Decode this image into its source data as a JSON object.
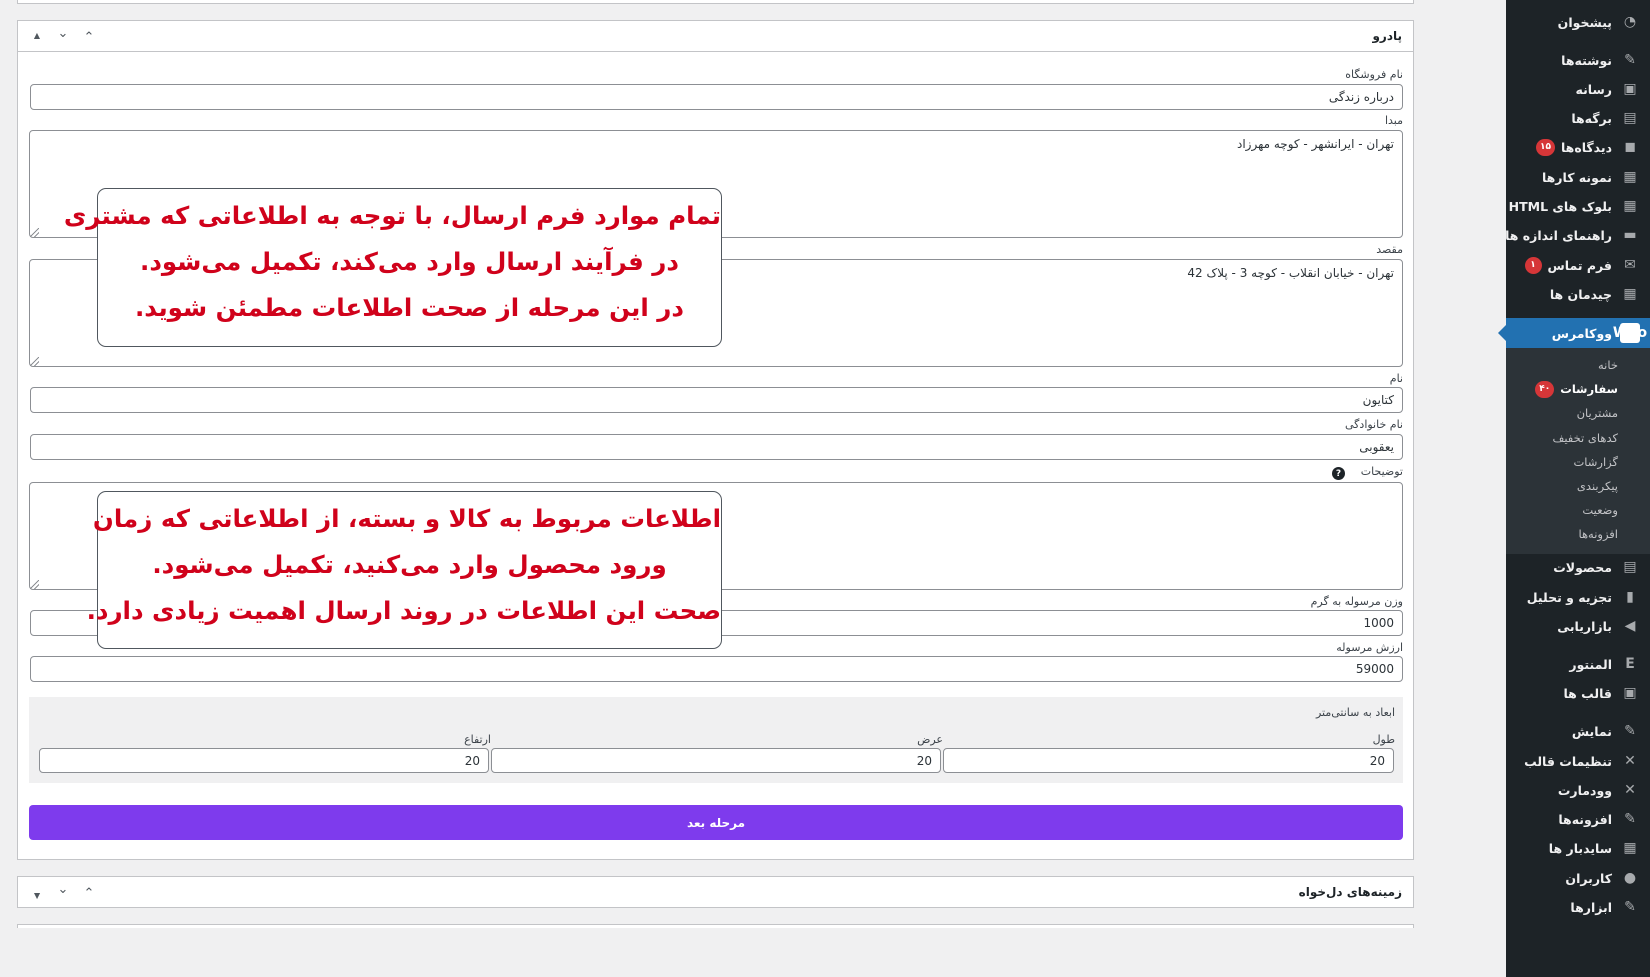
{
  "sidebar": {
    "items": [
      {
        "label": "پیشخوان",
        "icon": "dashboard-icon",
        "glyph": "◔"
      },
      {
        "label": "نوشته‌ها",
        "icon": "pin-icon",
        "glyph": "✎"
      },
      {
        "label": "رسانه",
        "icon": "media-icon",
        "glyph": "▣"
      },
      {
        "label": "برگه‌ها",
        "icon": "pages-icon",
        "glyph": "▤"
      },
      {
        "label": "دیدگاه‌ها",
        "icon": "comments-icon",
        "glyph": "◼",
        "badge": "۱۵"
      },
      {
        "label": "نمونه کارها",
        "icon": "portfolio-icon",
        "glyph": "▦"
      },
      {
        "label": "بلوک های HTML",
        "icon": "blocks-icon",
        "glyph": "▦"
      },
      {
        "label": "راهنمای اندازه ها",
        "icon": "size-guide-icon",
        "glyph": "▬"
      },
      {
        "label": "فرم تماس",
        "icon": "mail-icon",
        "glyph": "✉",
        "badge": "۱"
      },
      {
        "label": "چیدمان ها",
        "icon": "layouts-icon",
        "glyph": "▦"
      },
      {
        "label": "ووکامرس",
        "icon": "woocommerce-icon",
        "glyph": "Woo"
      },
      {
        "label": "محصولات",
        "icon": "products-icon",
        "glyph": "▤"
      },
      {
        "label": "تجزیه و تحلیل",
        "icon": "analytics-icon",
        "glyph": "▮"
      },
      {
        "label": "بازاریابی",
        "icon": "megaphone-icon",
        "glyph": "◀"
      },
      {
        "label": "المنتور",
        "icon": "elementor-icon",
        "glyph": "Ε"
      },
      {
        "label": "قالب ها",
        "icon": "templates-icon",
        "glyph": "▣"
      },
      {
        "label": "نمایش",
        "icon": "appearance-icon",
        "glyph": "✎"
      },
      {
        "label": "تنظیمات قالب",
        "icon": "theme-settings-icon",
        "glyph": "✕"
      },
      {
        "label": "وودمارت",
        "icon": "woodmart-icon",
        "glyph": "✕"
      },
      {
        "label": "افزونه‌ها",
        "icon": "plugins-icon",
        "glyph": "✎"
      },
      {
        "label": "سایدبار ها",
        "icon": "sidebars-icon",
        "glyph": "▦"
      },
      {
        "label": "کاربران",
        "icon": "users-icon",
        "glyph": "●"
      },
      {
        "label": "ابزارها",
        "icon": "tools-icon",
        "glyph": "✎"
      }
    ],
    "submenu": [
      {
        "label": "خانه"
      },
      {
        "label": "سفارشات",
        "badge": "۴۰"
      },
      {
        "label": "مشتریان"
      },
      {
        "label": "کدهای تخفیف"
      },
      {
        "label": "گزارشات"
      },
      {
        "label": "پیکربندی"
      },
      {
        "label": "وضعیت"
      },
      {
        "label": "افزونه‌ها"
      }
    ]
  },
  "panel": {
    "title": "پادرو",
    "controls": {
      "up": "▲",
      "collapse_down": "⌄",
      "expand_up": "⌃"
    },
    "fields": {
      "store_name": {
        "label": "نام فروشگاه",
        "value": "درباره زندگی"
      },
      "origin": {
        "label": "مبدا",
        "value": "تهران - ایرانشهر - کوچه مهرزاد"
      },
      "destination": {
        "label": "مقصد",
        "value": "تهران - خیابان انقلاب - کوچه 3 - پلاک 42"
      },
      "first_name": {
        "label": "نام",
        "value": "کتایون"
      },
      "last_name": {
        "label": "نام خانوادگی",
        "value": "یعقوبی"
      },
      "description": {
        "label": "توضیحات",
        "value": "",
        "help": "?"
      },
      "weight": {
        "label": "وزن مرسوله به گرم",
        "value": "1000"
      },
      "value": {
        "label": "ارزش مرسوله",
        "value": "59000"
      }
    },
    "dimensions": {
      "title": "ابعاد به سانتی‌متر",
      "length": {
        "label": "طول",
        "value": "20"
      },
      "width": {
        "label": "عرض",
        "value": "20"
      },
      "height": {
        "label": "ارتفاع",
        "value": "20"
      }
    },
    "next_button": "مرحله بعد"
  },
  "custom_fields_panel": {
    "title": "زمینه‌های دل‌خواه"
  },
  "callouts": {
    "first": {
      "line1": "تمام موارد فرم ارسال، با توجه به اطلاعاتی که مشتری",
      "line2": "در فرآیند ارسال وارد می‌کند، تکمیل می‌شود.",
      "line3": "در این مرحله از صحت اطلاعات مطمئن شوید."
    },
    "second": {
      "line1": "اطلاعات مربوط به کالا و بسته، از اطلاعاتی که زمان",
      "line2": "ورود محصول وارد می‌کنید، تکمیل می‌شود.",
      "line3": "صحت این اطلاعات در روند ارسال اهمیت زیادی دارد."
    }
  },
  "colors": {
    "sidebar_bg": "#1d2327",
    "active_menu": "#2271b1",
    "badge": "#d63638",
    "primary_button": "#7e3bed",
    "callout_text": "#d0021b"
  }
}
